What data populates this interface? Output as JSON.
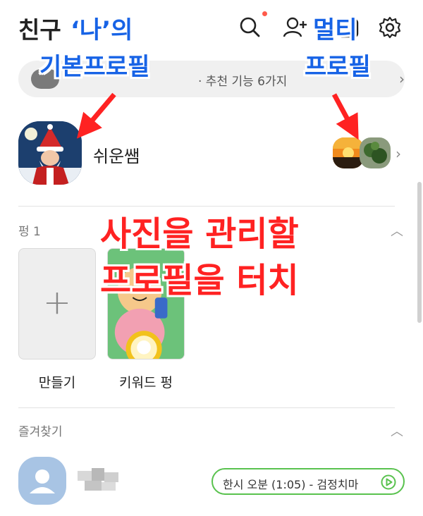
{
  "header": {
    "title": "친구",
    "icons": [
      "search-icon",
      "add-friend-icon",
      "calendar-icon",
      "settings-icon"
    ]
  },
  "banner": {
    "text": "· 추천 기능 6가지"
  },
  "my_profile": {
    "name": "쉬운쌤"
  },
  "pung_section": {
    "label": "펑 1",
    "items": [
      {
        "label": "만들기"
      },
      {
        "label": "키워드 펑"
      }
    ]
  },
  "favorites_section": {
    "label": "즐겨찾기",
    "items": [
      {
        "music_status": "한시 오분 (1:05) - 검정치마"
      }
    ]
  },
  "annotations": {
    "basic_profile_line1": "‘나’의",
    "basic_profile_line2": "기본프로필",
    "multi_profile_line1": "멀티",
    "multi_profile_line2": "프로필",
    "instruction_line1": "사진을 관리할",
    "instruction_line2": "프로필을 터치"
  },
  "colors": {
    "accent_green": "#59c24e",
    "annotation_blue": "#1763e6",
    "annotation_red": "#ff2222",
    "notification_dot": "#ff5a4a"
  }
}
